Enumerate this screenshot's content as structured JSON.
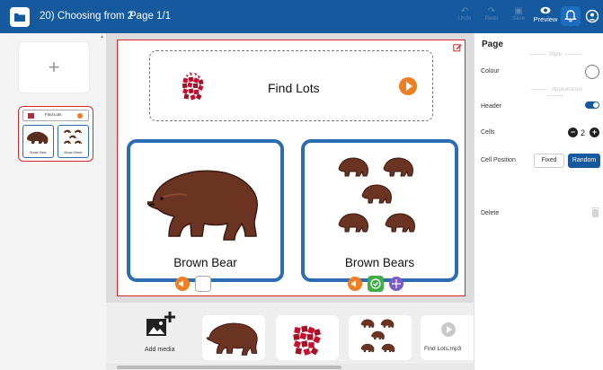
{
  "topbar": {
    "title": "20) Choosing from 2",
    "page_indicator": "Page 1/1",
    "undo_label": "Undo",
    "redo_label": "Redo",
    "save_label": "Save",
    "preview_label": "Preview",
    "bg_color": "#155a9e"
  },
  "left_panel": {
    "add_page_symbol": "+",
    "thumbnail": {
      "header_text": "Find Lots",
      "cell_labels": [
        "Brown Bear",
        "Brown Bears"
      ]
    }
  },
  "page": {
    "header": {
      "text": "Find Lots",
      "play_icon": "play-icon"
    },
    "cells": [
      {
        "label": "Brown Bear"
      },
      {
        "label": "Brown Bears"
      }
    ]
  },
  "media_bar": {
    "add_media_label": "Add media",
    "audio_file_label": "Find Lots.mp3"
  },
  "properties": {
    "title": "Page",
    "style_section": "Style",
    "colour_label": "Colour",
    "appearance_section": "Appearance",
    "header_label": "Header",
    "header_enabled": true,
    "cells_label": "Cells",
    "cells_value": "2",
    "cell_position_label": "Cell Position",
    "fixed_label": "Fixed",
    "random_label": "Random",
    "selected_position": "Random",
    "delete_label": "Delete"
  },
  "colors": {
    "accent": "#155a9e",
    "cell_border": "#2b6cb2",
    "selection": "#d62828",
    "orange": "#f07e22",
    "green": "#3fae49",
    "purple": "#7a5cc7"
  }
}
